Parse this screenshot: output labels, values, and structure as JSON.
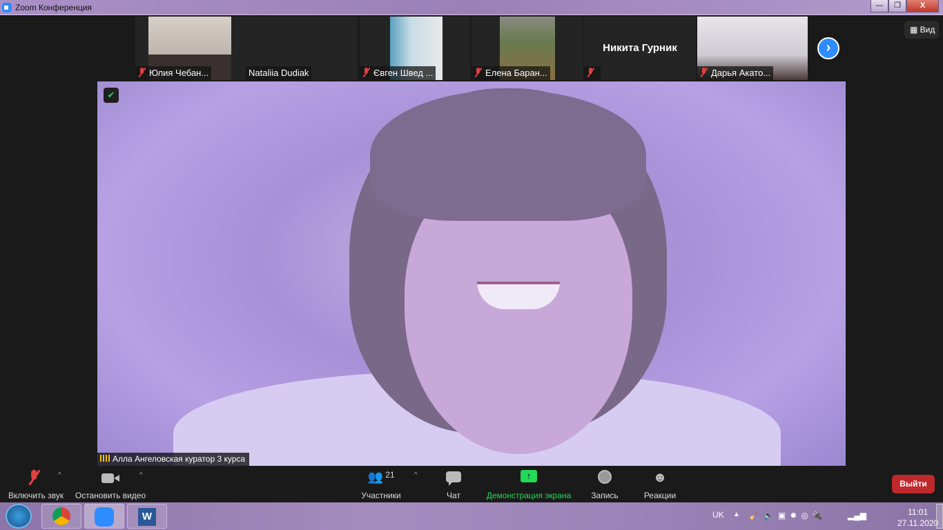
{
  "window": {
    "title": "Zoom Конференция",
    "min": "—",
    "restore": "❐",
    "close": "X"
  },
  "participants_strip": [
    {
      "name": "Юлия Чебан...",
      "muted": true
    },
    {
      "name": "Nataliia Dudiak",
      "muted": false
    },
    {
      "name": "Євген Швед ...",
      "muted": true
    },
    {
      "name": "Елена Баран...",
      "muted": true
    },
    {
      "name": "",
      "big_name": "Никита Гурник",
      "muted": true
    },
    {
      "name": "Дарья Акато...",
      "muted": true
    }
  ],
  "next_icon": "›",
  "view_label": "Вид",
  "active_speaker": {
    "name": "Алла Ангеловская куратор 3 курса"
  },
  "toolbar": {
    "unmute": "Включить звук",
    "stop_video": "Остановить видео",
    "participants": "Участники",
    "participants_count": "21",
    "chat": "Чат",
    "share": "Демонстрация экрана",
    "record": "Запись",
    "reactions": "Реакции",
    "leave": "Выйти",
    "share_color": "#23d959",
    "leave_color": "#c0282c"
  },
  "taskbar": {
    "lang": "UK",
    "time": "11:01",
    "date": "27.11.2020"
  }
}
